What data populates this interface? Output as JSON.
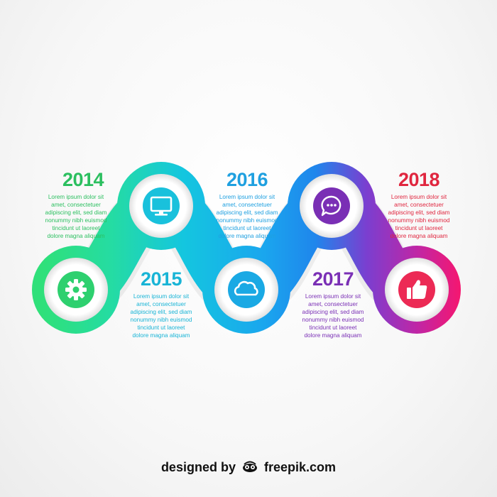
{
  "colors": {
    "green": "#2ed573",
    "teal": "#19c3d8",
    "blue": "#1a8ee8",
    "purple": "#7a2fb5",
    "pink": "#f5186b",
    "red": "#e8253b"
  },
  "milestones": [
    {
      "year": "2014",
      "color": "#2bbf5f",
      "icon": "gear-icon",
      "icon_color": "#2ed06f",
      "text": "Lorem ipsum dolor sit\namet, consectetuer\nadipiscing elit, sed diam\nnonummy nibh euismod\ntincidunt ut laoreet\ndolore magna aliquam"
    },
    {
      "year": "2015",
      "color": "#18b4d6",
      "icon": "cloud-icon",
      "icon_color": "#1aa9e4",
      "text": "Lorem ipsum dolor sit\namet, consectetuer\nadipiscing elit, sed diam\nnonummy nibh euismod\ntincidunt ut laoreet\ndolore magna aliquam"
    },
    {
      "year": "2016",
      "color": "#1fa0e0",
      "icon": "monitor-icon",
      "icon_color": "#19c1dc",
      "text": "Lorem ipsum dolor sit\namet, consectetuer\nadipiscing elit, sed diam\nnonummy nibh euismod\ntincidunt ut laoreet\ndolore magna aliquam"
    },
    {
      "year": "2017",
      "color": "#7a2fb5",
      "icon": "chat-bubble-icon",
      "icon_color": "#7a2fb5",
      "text": "Lorem ipsum dolor sit\namet, consectetuer\nadipiscing elit, sed diam\nnonummy nibh euismod\ntincidunt ut laoreet\ndolore magna aliquam"
    },
    {
      "year": "2018",
      "color": "#e0263f",
      "icon": "thumbs-up-icon",
      "icon_color": "#ec2a55",
      "text": "Lorem ipsum dolor sit\namet, consectetuer\nadipiscing elit, sed diam\nnonummy nibh euismod\ntincidunt ut laoreet\ndolore magna aliquam"
    }
  ],
  "footer": {
    "prefix": "designed by",
    "brand": "freepik.com",
    "logo_icon": "freepik-logo-icon"
  }
}
